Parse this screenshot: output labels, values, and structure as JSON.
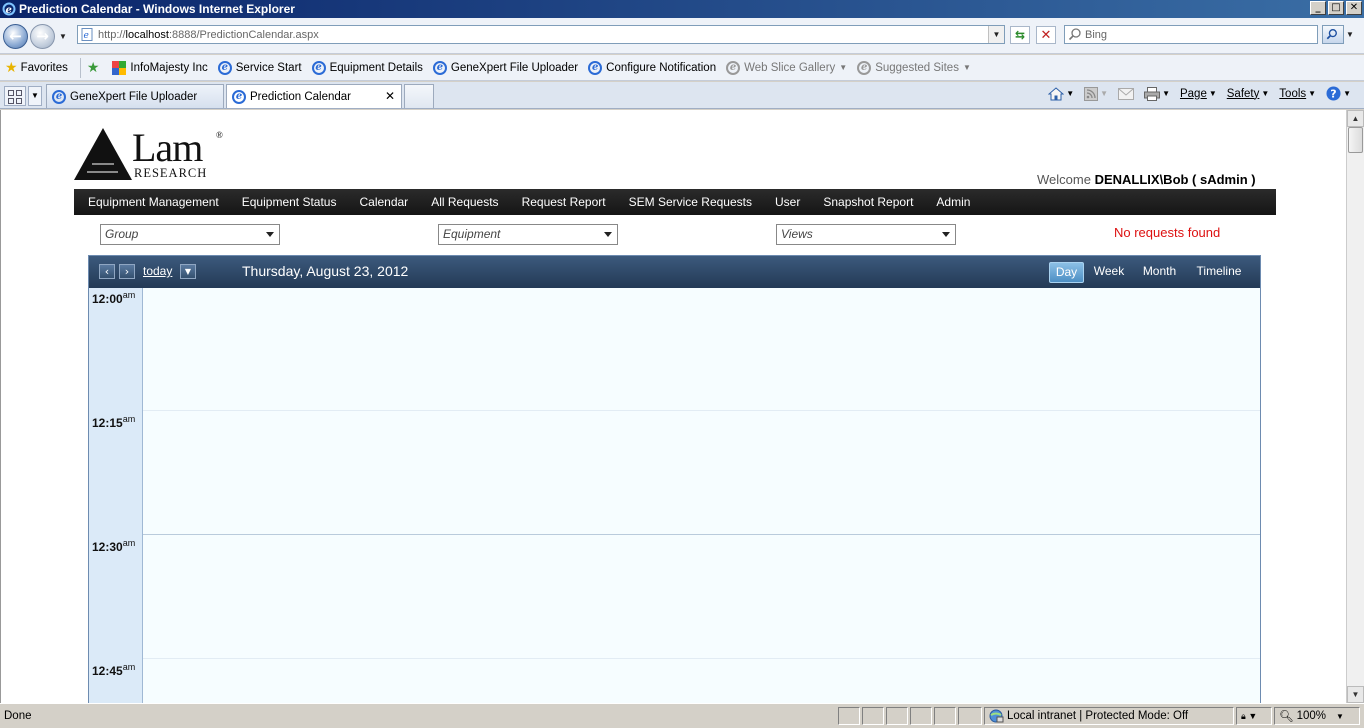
{
  "window": {
    "title": "Prediction Calendar - Windows Internet Explorer",
    "buttons": [
      "_",
      "□",
      "✕"
    ]
  },
  "address": {
    "prefix": "http://",
    "host": "localhost",
    "rest": ":8888/PredictionCalendar.aspx"
  },
  "search": {
    "placeholder": "Bing"
  },
  "favorites": {
    "label": "Favorites",
    "items": [
      {
        "label": "InfoMajesty Inc",
        "icon": "infomajesty-icon",
        "dim": false
      },
      {
        "label": "Service Start",
        "icon": "ie-page-icon",
        "dim": false
      },
      {
        "label": "Equipment Details",
        "icon": "ie-page-icon",
        "dim": false
      },
      {
        "label": "GeneXpert File Uploader",
        "icon": "ie-page-icon",
        "dim": false
      },
      {
        "label": "Configure Notification",
        "icon": "ie-page-icon",
        "dim": false
      },
      {
        "label": "Web Slice Gallery",
        "icon": "web-slice-icon",
        "dim": true
      },
      {
        "label": "Suggested Sites",
        "icon": "suggested-sites-icon",
        "dim": true
      }
    ]
  },
  "tabs": [
    {
      "label": "GeneXpert File Uploader",
      "active": false
    },
    {
      "label": "Prediction Calendar",
      "active": true
    }
  ],
  "commandbar": {
    "page": "Page",
    "safety": "Safety",
    "tools": "Tools"
  },
  "site": {
    "logo_main": "Lam",
    "logo_reg": "®",
    "logo_sub": "RESEARCH",
    "welcome_prefix": "Welcome ",
    "welcome_user": "DENALLIX\\Bob ( sAdmin )",
    "nav": [
      "Equipment Management",
      "Equipment Status",
      "Calendar",
      "All Requests",
      "Request Report",
      "SEM Service Requests",
      "User",
      "Snapshot Report",
      "Admin"
    ],
    "filters": {
      "group": "Group",
      "equipment": "Equipment",
      "views": "Views"
    },
    "no_requests": "No requests found"
  },
  "calendar": {
    "today_label": "today",
    "date": "Thursday, August 23, 2012",
    "views": [
      "Day",
      "Week",
      "Month",
      "Timeline"
    ],
    "active_view": "Day",
    "times": [
      {
        "time": "12:00",
        "ampm": "am"
      },
      {
        "time": "12:15",
        "ampm": "am"
      },
      {
        "time": "12:30",
        "ampm": "am"
      },
      {
        "time": "12:45",
        "ampm": "am"
      }
    ]
  },
  "status": {
    "text": "Done",
    "zone": "Local intranet | Protected Mode: Off",
    "zoom": "100%"
  },
  "colors": {
    "nav_bg": "#1c1c1c",
    "calendar_header": "#2d4868",
    "time_column": "#dbeaf8",
    "no_requests": "#dd1111",
    "active_view": "#5d9bcc"
  }
}
